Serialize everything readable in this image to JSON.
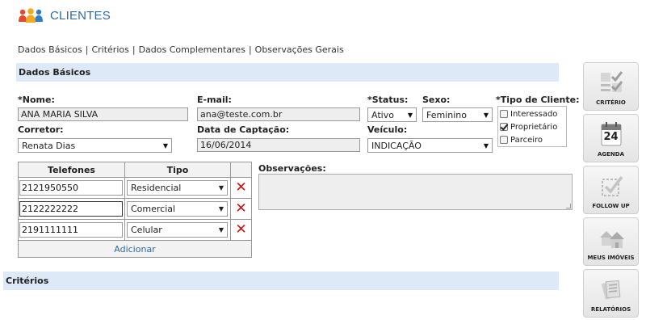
{
  "header": {
    "title": "CLIENTES",
    "icon": "users-icon"
  },
  "subnav": {
    "items": [
      "Dados Básicos",
      "Critérios",
      "Dados Complementares",
      "Observações Gerais"
    ],
    "separator": "|"
  },
  "section_dados": {
    "title": "Dados Básicos"
  },
  "form": {
    "nome_label": "*Nome:",
    "nome_value": "ANA MARIA SILVA",
    "email_label": "E-mail:",
    "email_value": "ana@teste.com.br",
    "status_label": "*Status:",
    "status_value": "Ativo",
    "sexo_label": "Sexo:",
    "sexo_value": "Feminino",
    "tipo_label": "*Tipo de Cliente:",
    "tipo_options": [
      {
        "label": "Interessado",
        "checked": false
      },
      {
        "label": "Proprietário",
        "checked": true
      },
      {
        "label": "Parceiro",
        "checked": false
      }
    ],
    "corretor_label": "Corretor:",
    "corretor_value": "Renata Dias",
    "captacao_label": "Data de Captação:",
    "captacao_value": "16/06/2014",
    "veiculo_label": "Veículo:",
    "veiculo_value": "INDICAÇÃO",
    "observacoes_label": "Observações:",
    "observacoes_value": ""
  },
  "phones": {
    "col_telefones": "Telefones",
    "col_tipo": "Tipo",
    "rows": [
      {
        "number": "2121950550",
        "tipo": "Residencial"
      },
      {
        "number": "2122222222",
        "tipo": "Comercial"
      },
      {
        "number": "2191111111",
        "tipo": "Celular"
      }
    ],
    "add_label": "Adicionar",
    "remove_glyph": "✕"
  },
  "section_criterios": {
    "title": "Critérios"
  },
  "sidebar": {
    "buttons": [
      {
        "label": "CRITÉRIO",
        "icon": "checklist-icon"
      },
      {
        "label": "AGENDA",
        "icon": "calendar-icon",
        "day": "24"
      },
      {
        "label": "FOLLOW UP",
        "icon": "followup-check-icon"
      },
      {
        "label": "MEUS IMÓVEIS",
        "icon": "houses-icon"
      },
      {
        "label": "RELATÓRIOS",
        "icon": "reports-icon"
      }
    ]
  },
  "colors": {
    "accent": "#2e6aa6",
    "section_bg": "#dde9f7",
    "delete_red": "#cc1111"
  }
}
